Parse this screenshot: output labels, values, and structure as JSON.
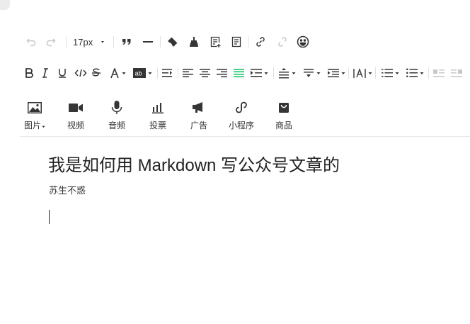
{
  "toolbar": {
    "font_size": "17px",
    "buttons_row1": [
      "undo-icon",
      "redo-icon",
      "quote-icon",
      "horizontal-rule-icon",
      "clear-format-icon",
      "format-painter-icon",
      "insert-template-icon",
      "template-icon",
      "link-icon",
      "unlink-icon",
      "emoji-icon"
    ],
    "buttons_row2": [
      "bold-icon",
      "italic-icon",
      "underline-icon",
      "code-icon",
      "strikethrough-icon",
      "font-color-icon",
      "background-color-icon",
      "indent-icon",
      "align-left-icon",
      "align-center-icon",
      "align-right-icon",
      "justify-icon",
      "text-indent-icon",
      "line-height-icon",
      "paragraph-spacing-icon",
      "letter-spacing-icon",
      "ordered-list-icon",
      "unordered-list-icon",
      "float-left-icon",
      "float-right-icon"
    ]
  },
  "insert": {
    "items": [
      {
        "label": "图片",
        "icon": "image-icon"
      },
      {
        "label": "视频",
        "icon": "video-icon"
      },
      {
        "label": "音频",
        "icon": "microphone-icon"
      },
      {
        "label": "投票",
        "icon": "poll-icon"
      },
      {
        "label": "广告",
        "icon": "megaphone-icon"
      },
      {
        "label": "小程序",
        "icon": "miniprogram-icon"
      },
      {
        "label": "商品",
        "icon": "shopping-bag-icon"
      }
    ]
  },
  "document": {
    "title": "我是如何用 Markdown 写公众号文章的",
    "author": "苏生不惑"
  },
  "colors": {
    "justify_active": "#07c160",
    "icon": "#353535",
    "disabled": "#c8c8c8"
  }
}
